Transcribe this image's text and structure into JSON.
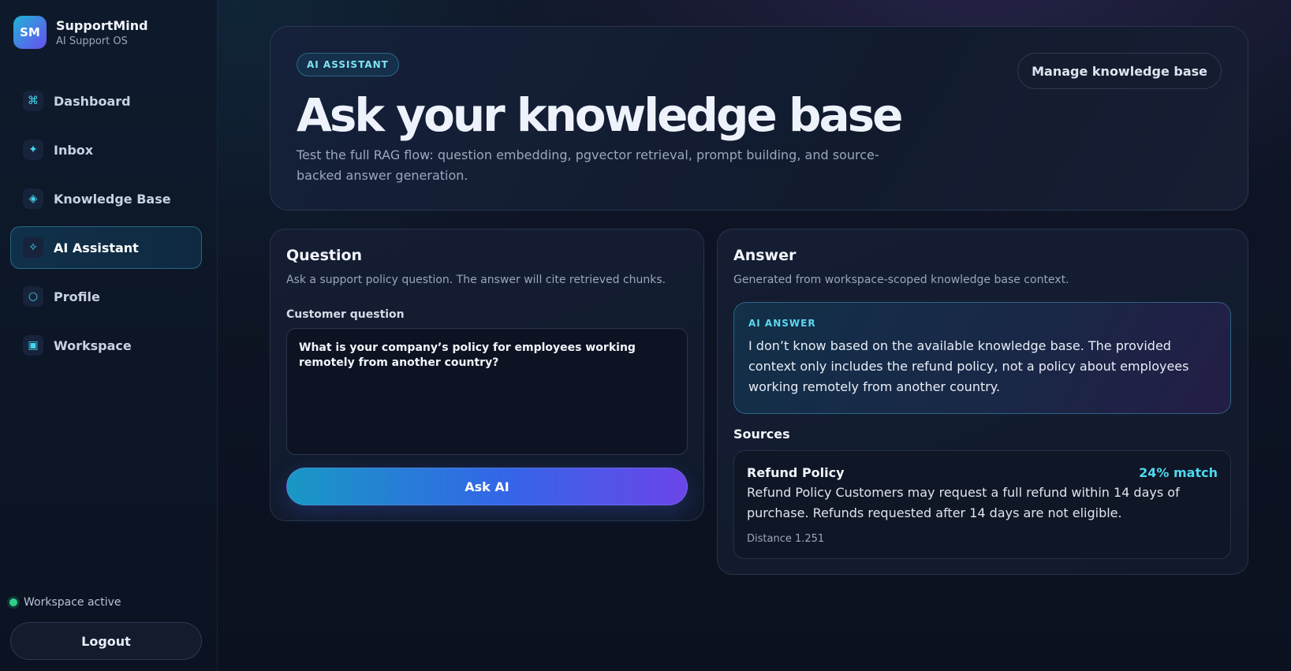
{
  "brand": {
    "logo": "SM",
    "name": "SupportMind",
    "subtitle": "AI Support OS"
  },
  "sidebar": {
    "items": [
      {
        "label": "Dashboard",
        "icon": "⌘"
      },
      {
        "label": "Inbox",
        "icon": "✦"
      },
      {
        "label": "Knowledge Base",
        "icon": "◈"
      },
      {
        "label": "AI Assistant",
        "icon": "✧",
        "active": true
      },
      {
        "label": "Profile",
        "icon": "○"
      },
      {
        "label": "Workspace",
        "icon": "▣"
      }
    ],
    "workspace_status": "Workspace active",
    "logout_label": "Logout"
  },
  "hero": {
    "chip": "AI ASSISTANT",
    "title": "Ask your knowledge base",
    "description": "Test the full RAG flow: question embedding, pgvector retrieval, prompt building, and source-backed answer generation.",
    "manage_label": "Manage knowledge base"
  },
  "question": {
    "title": "Question",
    "subtitle": "Ask a support policy question. The answer will cite retrieved chunks.",
    "field_label": "Customer question",
    "value": "What is your company’s policy for employees working remotely from another country?",
    "ask_label": "Ask AI"
  },
  "answer": {
    "title": "Answer",
    "subtitle": "Generated from workspace-scoped knowledge base context.",
    "kicker": "AI ANSWER",
    "text": "I don’t know based on the available knowledge base. The provided context only includes the refund policy, not a policy about employees working remotely from another country.",
    "sources_title": "Sources",
    "sources": [
      {
        "title": "Refund Policy",
        "match": "24% match",
        "text": "Refund Policy Customers may request a full refund within 14 days of purchase. Refunds requested after 14 days are not eligible.",
        "distance": "Distance 1.251"
      }
    ]
  },
  "colors": {
    "accent": "#44d4ec",
    "status_active": "#2ed08a",
    "gradient_start": "#1898c4",
    "gradient_end": "#6b45e8"
  }
}
